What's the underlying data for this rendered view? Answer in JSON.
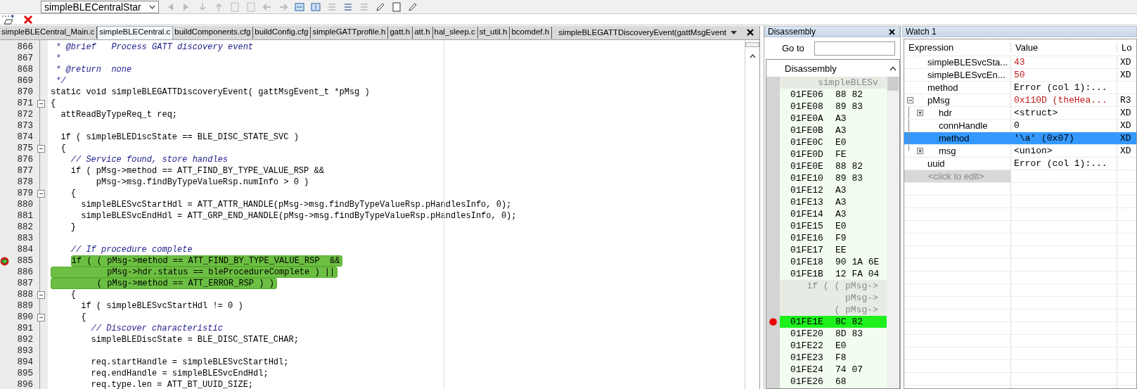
{
  "toolbar": {
    "configuration": "simpleBLECentralStar"
  },
  "editor": {
    "tabs": [
      {
        "label": "simpleBLECentral_Main.c",
        "selected": false
      },
      {
        "label": "simpleBLECentral.c",
        "selected": true
      },
      {
        "label": "buildComponents.cfg",
        "selected": false
      },
      {
        "label": "buildConfig.cfg",
        "selected": false
      },
      {
        "label": "simpleGATTprofile.h",
        "selected": false
      },
      {
        "label": "gatt.h",
        "selected": false
      },
      {
        "label": "att.h",
        "selected": false
      },
      {
        "label": "hal_sleep.c",
        "selected": false
      },
      {
        "label": "st_util.h",
        "selected": false
      },
      {
        "label": "bcomdef.h",
        "selected": false
      }
    ],
    "function_selector": "simpleBLEGATTDiscoveryEvent(gattMsgEvent",
    "lines": [
      {
        "number": "866",
        "text": " * @brief   Process GATT discovery event",
        "kind": "comment"
      },
      {
        "number": "867",
        "text": " *",
        "kind": "comment"
      },
      {
        "number": "868",
        "text": " * @return  none",
        "kind": "comment"
      },
      {
        "number": "869",
        "text": " */",
        "kind": "comment"
      },
      {
        "number": "870",
        "text": "static void simpleBLEGATTDiscoveryEvent( gattMsgEvent_t *pMsg )",
        "kind": "code"
      },
      {
        "number": "871",
        "text": "{",
        "kind": "code",
        "expanded": true
      },
      {
        "number": "872",
        "text": "  attReadByTypeReq_t req;",
        "kind": "code"
      },
      {
        "number": "873"
      },
      {
        "number": "874",
        "text": "  if ( simpleBLEDiscState == BLE_DISC_STATE_SVC )",
        "kind": "code"
      },
      {
        "number": "875",
        "text": "  {",
        "kind": "code",
        "expanded": true
      },
      {
        "number": "876",
        "text": "    // Service found, store handles",
        "kind": "comment"
      },
      {
        "number": "877",
        "text": "    if ( pMsg->method == ATT_FIND_BY_TYPE_VALUE_RSP &&",
        "kind": "code"
      },
      {
        "number": "878",
        "text": "         pMsg->msg.findByTypeValueRsp.numInfo > 0 )",
        "kind": "code"
      },
      {
        "number": "879",
        "text": "    {",
        "kind": "code",
        "expanded": true
      },
      {
        "number": "880",
        "text": "      simpleBLESvcStartHdl = ATT_ATTR_HANDLE(pMsg->msg.findByTypeValueRsp.pHandlesInfo, 0);",
        "kind": "code"
      },
      {
        "number": "881",
        "text": "      simpleBLESvcEndHdl = ATT_GRP_END_HANDLE(pMsg->msg.findByTypeValueRsp.pHandlesInfo, 0);",
        "kind": "code"
      },
      {
        "number": "882",
        "text": "    }",
        "kind": "code"
      },
      {
        "number": "883"
      },
      {
        "number": "884",
        "text": "    // If procedure complete",
        "kind": "comment"
      },
      {
        "number": "885",
        "text": "    if ( ( pMsg->method == ATT_FIND_BY_TYPE_VALUE_RSP  &&",
        "kind": "code",
        "current": true,
        "highlighted": true
      },
      {
        "number": "886",
        "text": "           pMsg->hdr.status == bleProcedureComplete ) ||",
        "kind": "code",
        "highlighted": true
      },
      {
        "number": "887",
        "text": "         ( pMsg->method == ATT_ERROR_RSP ) )",
        "kind": "code",
        "highlighted": true
      },
      {
        "number": "888",
        "text": "    {",
        "kind": "code",
        "expanded": true
      },
      {
        "number": "889",
        "text": "      if ( simpleBLESvcStartHdl != 0 )",
        "kind": "code"
      },
      {
        "number": "890",
        "text": "      {",
        "kind": "code",
        "expanded": true
      },
      {
        "number": "891",
        "text": "        // Discover characteristic",
        "kind": "comment"
      },
      {
        "number": "892",
        "text": "        simpleBLEDiscState = BLE_DISC_STATE_CHAR;",
        "kind": "code"
      },
      {
        "number": "893"
      },
      {
        "number": "894",
        "text": "        req.startHandle = simpleBLESvcStartHdl;",
        "kind": "code"
      },
      {
        "number": "895",
        "text": "        req.endHandle = simpleBLESvcEndHdl;",
        "kind": "code"
      },
      {
        "number": "896",
        "text": "        req.type.len = ATT_BT_UUID_SIZE;",
        "kind": "code"
      }
    ]
  },
  "disassembly": {
    "title": "Disassembly",
    "goto_label": "Go to",
    "list_header": "Disassembly",
    "rows": [
      {
        "kind": "source",
        "text": "     simpleBLESv"
      },
      {
        "kind": "code",
        "address": "01FE06",
        "bytes": "88 82",
        "current": false,
        "breakpoint": false
      },
      {
        "kind": "code",
        "address": "01FE08",
        "bytes": "89 83",
        "current": false,
        "breakpoint": false
      },
      {
        "kind": "code",
        "address": "01FE0A",
        "bytes": "A3",
        "current": false,
        "breakpoint": false
      },
      {
        "kind": "code",
        "address": "01FE0B",
        "bytes": "A3",
        "current": false,
        "breakpoint": false
      },
      {
        "kind": "code",
        "address": "01FE0C",
        "bytes": "E0",
        "current": false,
        "breakpoint": false
      },
      {
        "kind": "code",
        "address": "01FE0D",
        "bytes": "FE",
        "current": false,
        "breakpoint": false
      },
      {
        "kind": "code",
        "address": "01FE0E",
        "bytes": "88 82",
        "current": false,
        "breakpoint": false
      },
      {
        "kind": "code",
        "address": "01FE10",
        "bytes": "89 83",
        "current": false,
        "breakpoint": false
      },
      {
        "kind": "code",
        "address": "01FE12",
        "bytes": "A3",
        "current": false,
        "breakpoint": false
      },
      {
        "kind": "code",
        "address": "01FE13",
        "bytes": "A3",
        "current": false,
        "breakpoint": false
      },
      {
        "kind": "code",
        "address": "01FE14",
        "bytes": "A3",
        "current": false,
        "breakpoint": false
      },
      {
        "kind": "code",
        "address": "01FE15",
        "bytes": "E0",
        "current": false,
        "breakpoint": false
      },
      {
        "kind": "code",
        "address": "01FE16",
        "bytes": "F9",
        "current": false,
        "breakpoint": false
      },
      {
        "kind": "code",
        "address": "01FE17",
        "bytes": "EE",
        "current": false,
        "breakpoint": false
      },
      {
        "kind": "code",
        "address": "01FE18",
        "bytes": "90 1A 6E",
        "current": false,
        "breakpoint": false
      },
      {
        "kind": "code",
        "address": "01FE1B",
        "bytes": "12 FA 04",
        "current": false,
        "breakpoint": false
      },
      {
        "kind": "source",
        "text": "   if ( ( pMsg->"
      },
      {
        "kind": "source",
        "text": "          pMsg->"
      },
      {
        "kind": "source",
        "text": "        ( pMsg->"
      },
      {
        "kind": "code",
        "address": "01FE1E",
        "bytes": "8C 82",
        "current": true,
        "breakpoint": true
      },
      {
        "kind": "code",
        "address": "01FE20",
        "bytes": "8D 83",
        "current": false,
        "breakpoint": false
      },
      {
        "kind": "code",
        "address": "01FE22",
        "bytes": "E0",
        "current": false,
        "breakpoint": false
      },
      {
        "kind": "code",
        "address": "01FE23",
        "bytes": "F8",
        "current": false,
        "breakpoint": false
      },
      {
        "kind": "code",
        "address": "01FE24",
        "bytes": "74 07",
        "current": false,
        "breakpoint": false
      },
      {
        "kind": "code",
        "address": "01FE26",
        "bytes": "68",
        "current": false,
        "breakpoint": false
      }
    ]
  },
  "watch": {
    "title": "Watch 1",
    "columns": [
      "Expression",
      "Value",
      "Lo"
    ],
    "rows": [
      {
        "expression": "simpleBLESvcSta...",
        "value": "43",
        "column_3": "XD",
        "changed": true,
        "selected": false
      },
      {
        "expression": "simpleBLESvcEn...",
        "value": "50",
        "column_3": "XD",
        "changed": true,
        "selected": false
      },
      {
        "expression": "method",
        "value": "Error (col 1):...",
        "changed": false,
        "selected": false
      },
      {
        "expression": "pMsg",
        "value": "0x110D (theHea...",
        "column_3": "R3",
        "changed": true,
        "selected": false,
        "expanded": true,
        "children": [
          {
            "expression": "hdr",
            "value": "<struct>",
            "column_3": "XD",
            "changed": false,
            "selected": false,
            "expanded": false
          },
          {
            "expression": "connHandle",
            "value": "0",
            "column_3": "XD",
            "changed": false,
            "selected": false
          },
          {
            "expression": "method",
            "value": "'\\a' (0x07)",
            "column_3": "XD",
            "changed": false,
            "selected": true
          },
          {
            "expression": "msg",
            "value": "<union>",
            "column_3": "XD",
            "changed": false,
            "selected": false,
            "expanded": false
          }
        ]
      },
      {
        "expression": "uuid",
        "value": "Error (col 1):...",
        "changed": false,
        "selected": false
      }
    ],
    "new_entry_hint": "<click to edit>"
  }
}
